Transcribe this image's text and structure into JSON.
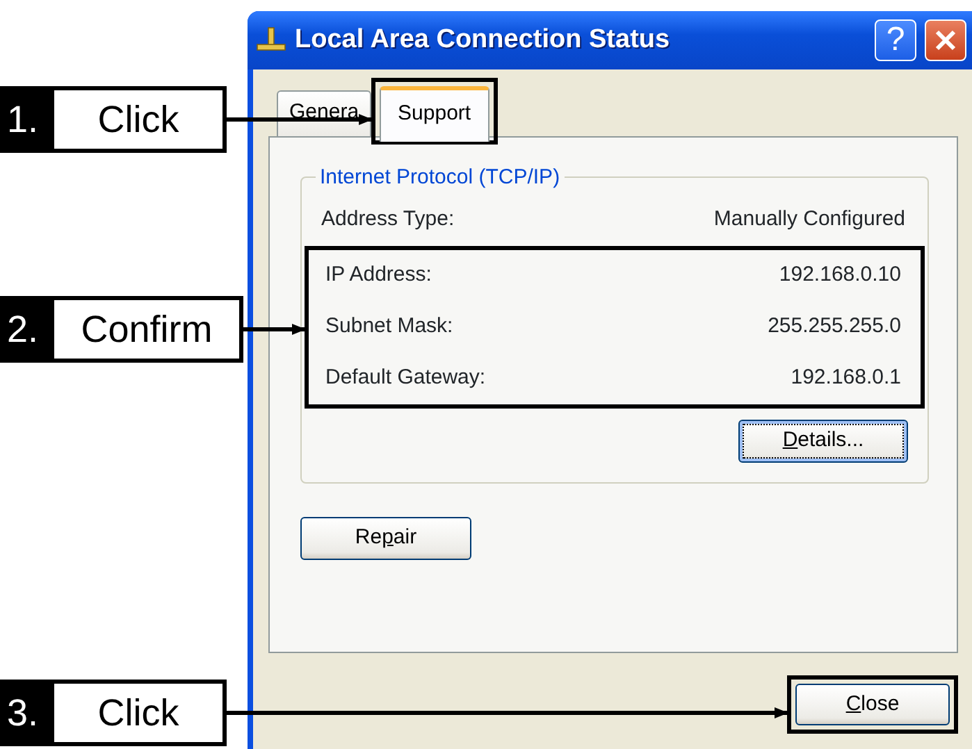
{
  "window": {
    "title": "Local Area Connection Status",
    "help_label": "?"
  },
  "tabs": [
    {
      "label": "Genera",
      "selected": false,
      "highlighted": false
    },
    {
      "label": "Support",
      "selected": true,
      "highlighted": true
    }
  ],
  "group": {
    "title": "Internet Protocol (TCP/IP)",
    "rows": [
      {
        "label": "Address Type:",
        "value": "Manually Configured",
        "highlighted": false
      },
      {
        "label": "IP Address:",
        "value": "192.168.0.10",
        "highlighted": true
      },
      {
        "label": "Subnet Mask:",
        "value": "255.255.255.0",
        "highlighted": true
      },
      {
        "label": "Default Gateway:",
        "value": "192.168.0.1",
        "highlighted": true
      }
    ],
    "button": {
      "key": "D",
      "after": "etails...",
      "focused": true
    }
  },
  "repair_button": {
    "before": "Re",
    "key": "p",
    "after": "air",
    "focused": false
  },
  "close_button": {
    "key": "C",
    "after": "lose",
    "focused": false,
    "highlighted": true
  },
  "annotations": [
    {
      "number": "1.",
      "label": "Click",
      "kind": "tab"
    },
    {
      "number": "2.",
      "label": "Confirm",
      "kind": "rows"
    },
    {
      "number": "3.",
      "label": "Click",
      "kind": "close"
    }
  ]
}
